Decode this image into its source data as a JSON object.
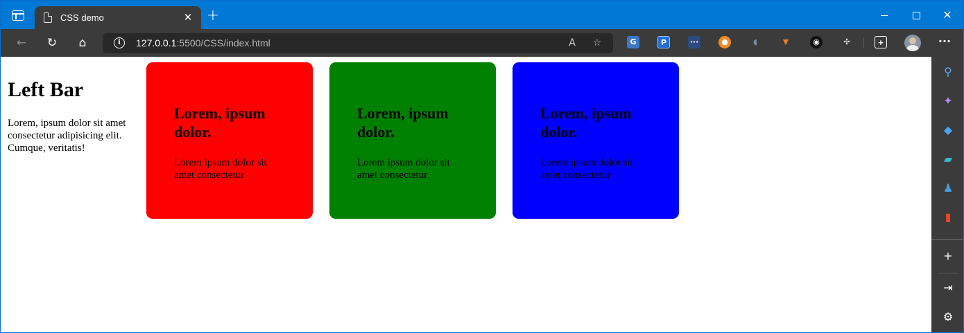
{
  "browser": {
    "tab": {
      "title": "CSS demo"
    },
    "address": {
      "host": "127.0.0.1",
      "rest": ":5500/CSS/index.html"
    }
  },
  "page": {
    "left_bar": {
      "heading": "Left Bar",
      "text": "Lorem, ipsum dolor sit amet consectetur adipisicing elit. Cumque, veritatis!"
    },
    "cards": [
      {
        "heading": "Lorem, ipsum dolor.",
        "text": "Lorem ipsum dolor sit amet consectetur",
        "color": "#ff0000"
      },
      {
        "heading": "Lorem, ipsum dolor.",
        "text": "Lorem ipsum dolor sit amet consectetur",
        "color": "#008000"
      },
      {
        "heading": "Lorem, ipsum dolor.",
        "text": "Lorem ipsum dolor sit amet consectetur",
        "color": "#0000ff"
      }
    ]
  },
  "colors": {
    "titlebar": "#0078d4",
    "toolbar": "#3b3b3b"
  }
}
